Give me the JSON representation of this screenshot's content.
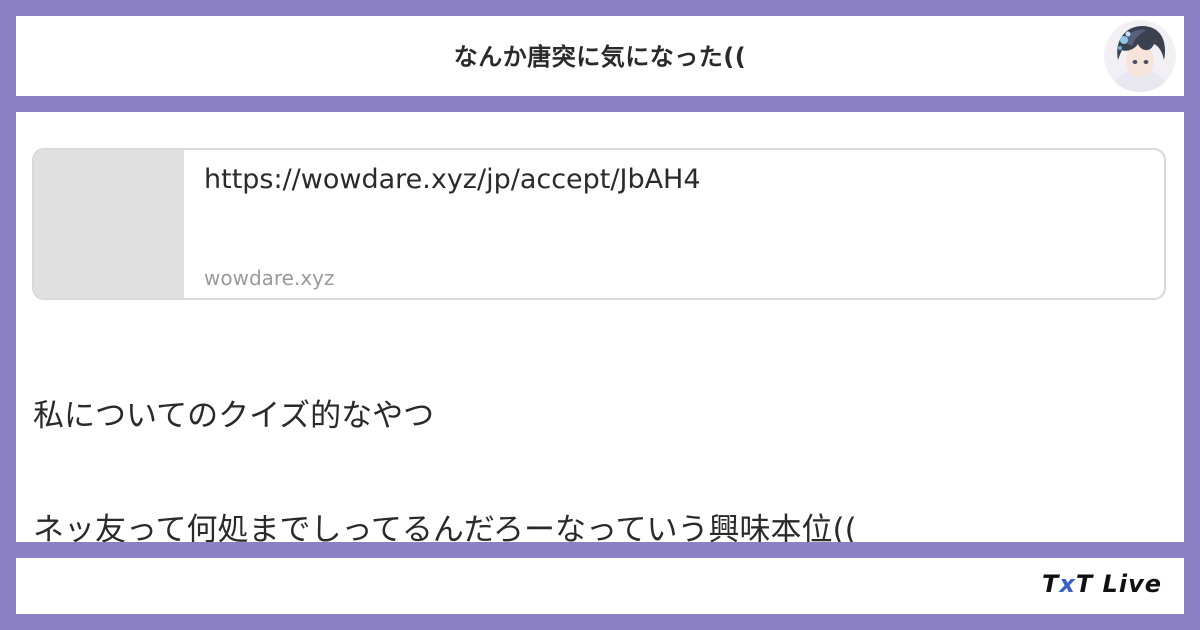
{
  "header": {
    "title": "なんか唐突に気になった(("
  },
  "link_card": {
    "url": "https://wowdare.xyz/jp/accept/JbAH4",
    "domain": "wowdare.xyz"
  },
  "body": {
    "line1": "私についてのクイズ的なやつ",
    "line2": "ネッ友って何処までしってるんだろーなっていう興味本位(("
  },
  "footer": {
    "brand_t1": "T",
    "brand_x": "x",
    "brand_t2": "T",
    "brand_live": " Live"
  },
  "colors": {
    "frame": "#8b80c4",
    "panel": "#ffffff",
    "thumb": "#e0e0e0",
    "brand_accent": "#3a5fc8"
  },
  "icons": {
    "avatar": "user-avatar-image"
  }
}
